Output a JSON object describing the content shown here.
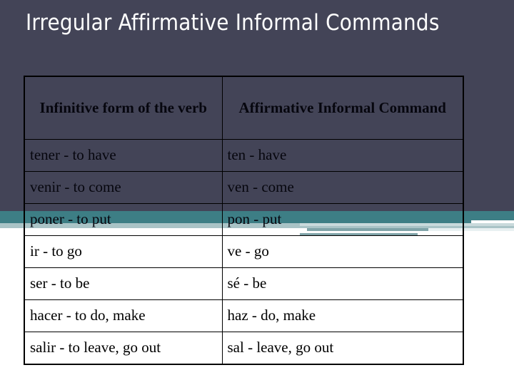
{
  "slide": {
    "title": "Irregular Affirmative Informal Commands",
    "background_color": "#434457",
    "accent_teal": "#3d7e85",
    "accent_light_teal": "#a9c3c6",
    "title_color": "#ffffff"
  },
  "table": {
    "headers": [
      "Infinitive form of the verb",
      "Affirmative Informal Command"
    ],
    "rows": [
      {
        "infinitive": "tener - to have",
        "command": "ten - have"
      },
      {
        "infinitive": "venir - to come",
        "command": "ven - come"
      },
      {
        "infinitive": "poner - to put",
        "command": "pon - put"
      },
      {
        "infinitive": "ir - to go",
        "command": "ve - go"
      },
      {
        "infinitive": "ser - to be",
        "command": "sé - be"
      },
      {
        "infinitive": "hacer - to do, make",
        "command": "haz - do, make"
      },
      {
        "infinitive": "salir - to leave, go out",
        "command": "sal - leave, go out"
      }
    ]
  }
}
